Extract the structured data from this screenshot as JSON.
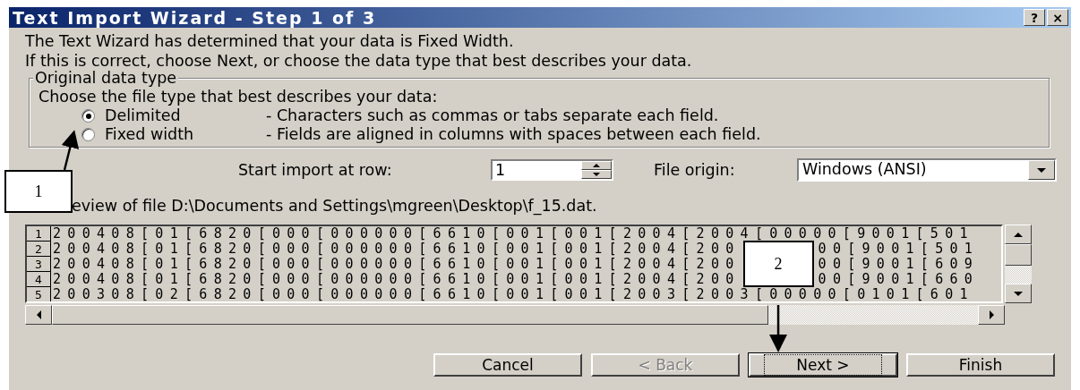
{
  "window": {
    "title": "Text Import Wizard - Step 1 of 3",
    "help_button": "?",
    "close_button": "×"
  },
  "intro": [
    "The Text Wizard has determined that your data is Fixed Width.",
    "If this is correct, choose Next, or choose the data type that best describes your data."
  ],
  "data_type": {
    "legend": "Original data type",
    "instruction": "Choose the file type that best describes your data:",
    "options": [
      {
        "label": "Delimited",
        "description": "- Characters such as commas or tabs separate each field.",
        "selected": true
      },
      {
        "label": "Fixed width",
        "description": "- Fields are aligned in columns with spaces between each field.",
        "selected": false
      }
    ]
  },
  "start_row": {
    "label": "Start import at row:",
    "value": "1"
  },
  "file_origin": {
    "label": "File origin:",
    "value": "Windows (ANSI)"
  },
  "preview": {
    "label": "eview of file D:\\Documents and Settings\\mgreen\\Desktop\\f_15.dat.",
    "rows": [
      {
        "number": "1",
        "text": "200408[01[6820[000[000000[6610[001[001[2004[2004[00000[9001[501"
      },
      {
        "number": "2",
        "text": "200408[01[6820[000[000000[6610[001[001[2004[200",
        "text_after": "00[9001[501"
      },
      {
        "number": "3",
        "text": "200408[01[6820[000[000000[6610[001[001[2004[200",
        "text_after": "00[9001[609"
      },
      {
        "number": "4",
        "text": "200408[01[6820[000[000000[6610[001[001[2004[200",
        "text_after": "00[9001[660"
      },
      {
        "number": "5",
        "text": "200308[02[6820[000[000000[6610[001[001[2003[2003[00000[0101[601"
      }
    ]
  },
  "buttons": [
    {
      "label": "Cancel",
      "disabled": false,
      "focused": false
    },
    {
      "label": "< Back",
      "disabled": true,
      "focused": false
    },
    {
      "label": "Next >",
      "disabled": false,
      "focused": true
    },
    {
      "label": "Finish",
      "disabled": false,
      "focused": false
    }
  ],
  "callouts": [
    {
      "label": "1"
    },
    {
      "label": "2"
    }
  ]
}
